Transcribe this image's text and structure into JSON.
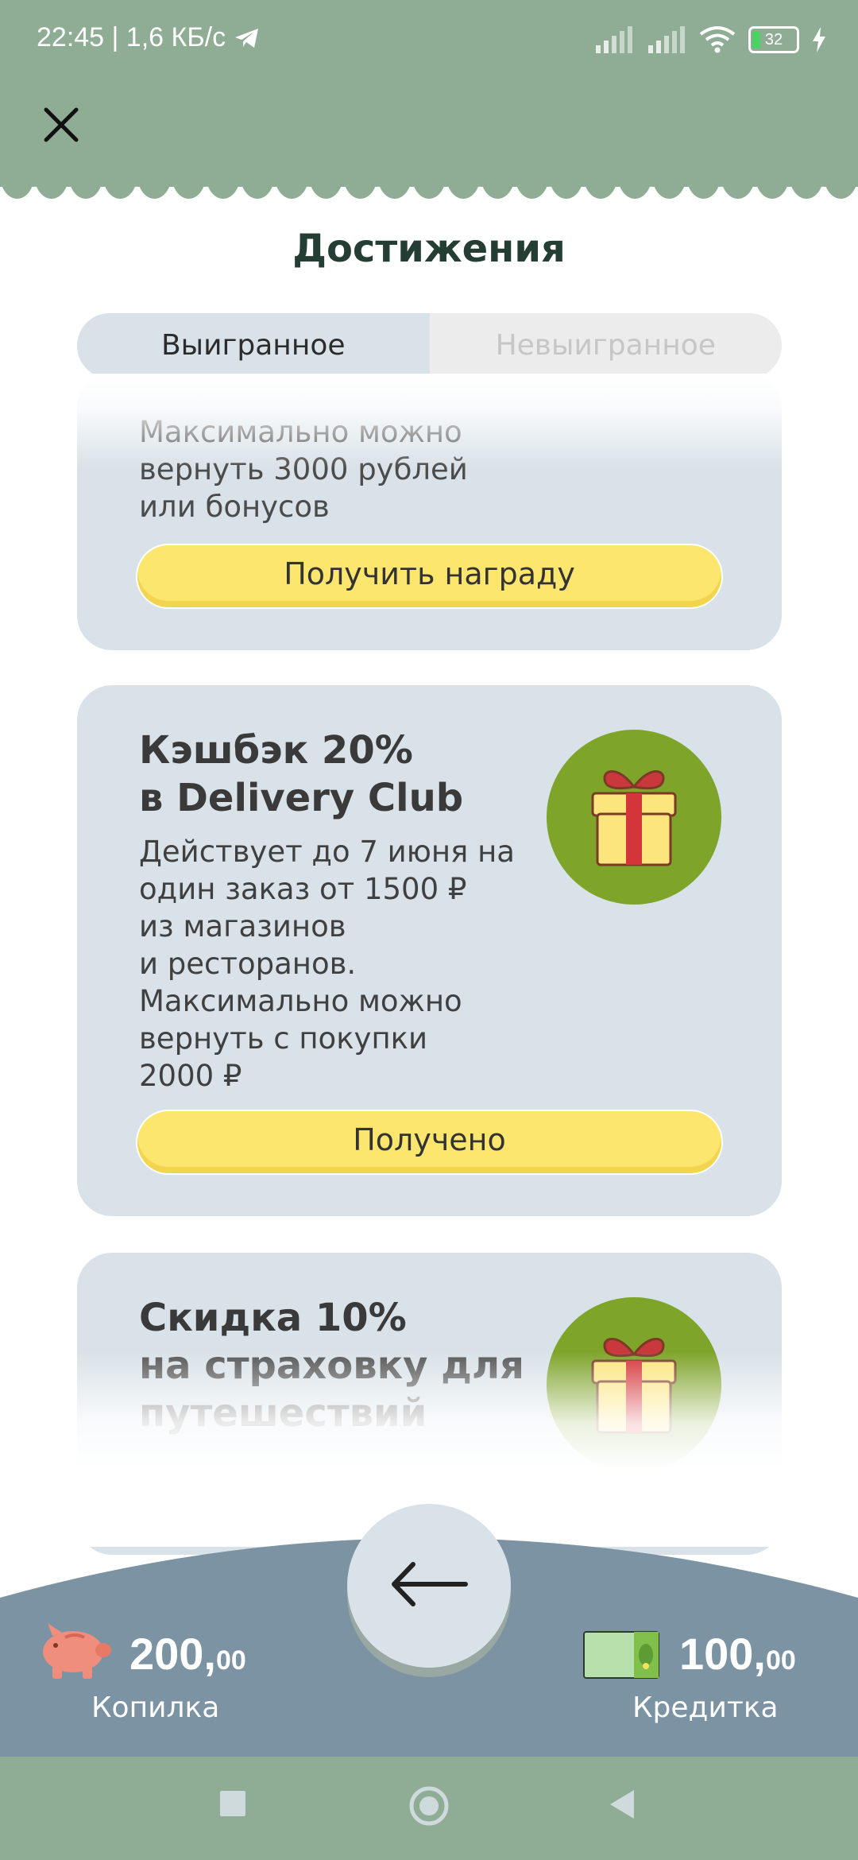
{
  "status_bar": {
    "time": "22:45 | 1,6 КБ/с",
    "battery": "32"
  },
  "header": {
    "title": "Достижения"
  },
  "tabs": [
    {
      "label": "Выигранное",
      "active": true
    },
    {
      "label": "Невыигранное",
      "active": false
    }
  ],
  "cards": [
    {
      "description_lines": [
        "Максимально можно",
        "вернуть 3000 рублей",
        "или бонусов"
      ],
      "button": "Получить награду"
    },
    {
      "title_lines": [
        "Кэшбэк 20%",
        "в Delivery Club"
      ],
      "description_lines": [
        "Действует до 7 июня на",
        "один заказ от 1500 ₽",
        "из магазинов",
        "и ресторанов.",
        "Максимально можно",
        "вернуть с покупки",
        "2000 ₽"
      ],
      "button": "Получено"
    },
    {
      "title_lines": [
        "Скидка 10%",
        "на страховку для",
        "путешествий"
      ]
    }
  ],
  "wallet": {
    "left": {
      "amount_int": "200,",
      "amount_dec": "00",
      "label": "Копилка"
    },
    "right": {
      "amount_int": "100,",
      "amount_dec": "00",
      "label": "Кредитка"
    }
  },
  "colors": {
    "header_green": "#8fac95",
    "card_bg": "#d9e2e8",
    "button_yellow": "#fde66d",
    "gift_green": "#7ea42a",
    "panel_gray": "#7b93a2"
  },
  "icons": [
    "close-icon",
    "gift-icon",
    "arrow-left-icon",
    "piggy-bank-icon",
    "credit-card-icon",
    "wifi-icon",
    "signal-icon",
    "battery-icon",
    "telegram-icon"
  ]
}
